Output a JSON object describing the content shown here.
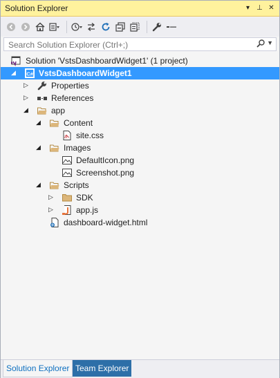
{
  "window": {
    "title": "Solution Explorer"
  },
  "title_buttons": [
    "▾",
    "⊥",
    "✕"
  ],
  "search": {
    "placeholder": "Search Solution Explorer (Ctrl+;)"
  },
  "tree": {
    "solution": "Solution 'VstsDashboardWidget1' (1 project)",
    "project": "VstsDashboardWidget1",
    "properties": "Properties",
    "references": "References",
    "app": "app",
    "content": "Content",
    "site_css": "site.css",
    "images": "Images",
    "default_icon": "DefaultIcon.png",
    "screenshot": "Screenshot.png",
    "scripts": "Scripts",
    "sdk": "SDK",
    "app_js": "app.js",
    "dashboard_widget": "dashboard-widget.html"
  },
  "tabs": {
    "solution_explorer": "Solution Explorer",
    "team_explorer": "Team Explorer"
  },
  "colors": {
    "title_bar": "#fff29d",
    "selection": "#3399ff",
    "inactive_tab": "#2d6fa8"
  }
}
